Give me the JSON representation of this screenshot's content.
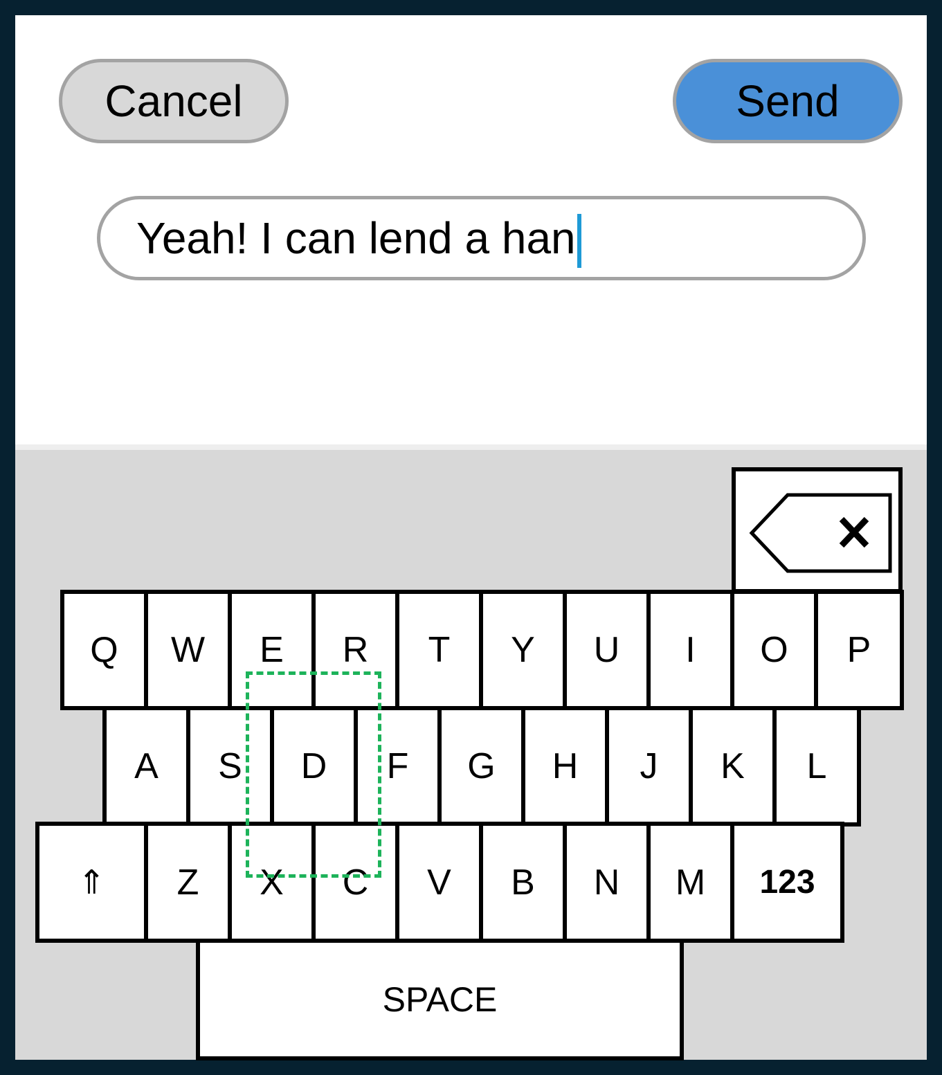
{
  "header": {
    "cancel_label": "Cancel",
    "send_label": "Send"
  },
  "message": {
    "value": "Yeah! I can lend a han"
  },
  "keyboard": {
    "row1": [
      "Q",
      "W",
      "E",
      "R",
      "T",
      "Y",
      "U",
      "I",
      "O",
      "P"
    ],
    "row2": [
      "A",
      "S",
      "D",
      "F",
      "G",
      "H",
      "J",
      "K",
      "L"
    ],
    "row3": [
      "⇑",
      "Z",
      "X",
      "C",
      "V",
      "B",
      "N",
      "M",
      "123"
    ],
    "space_label": "SPACE",
    "backspace_icon": "backspace-icon"
  },
  "colors": {
    "send_button": "#4a90d8",
    "cancel_button": "#d8d8d8",
    "caret": "#1e9ad6",
    "selection_box": "#1db35a",
    "frame": "#062130",
    "keyboard_bg": "#d8d8d8"
  }
}
